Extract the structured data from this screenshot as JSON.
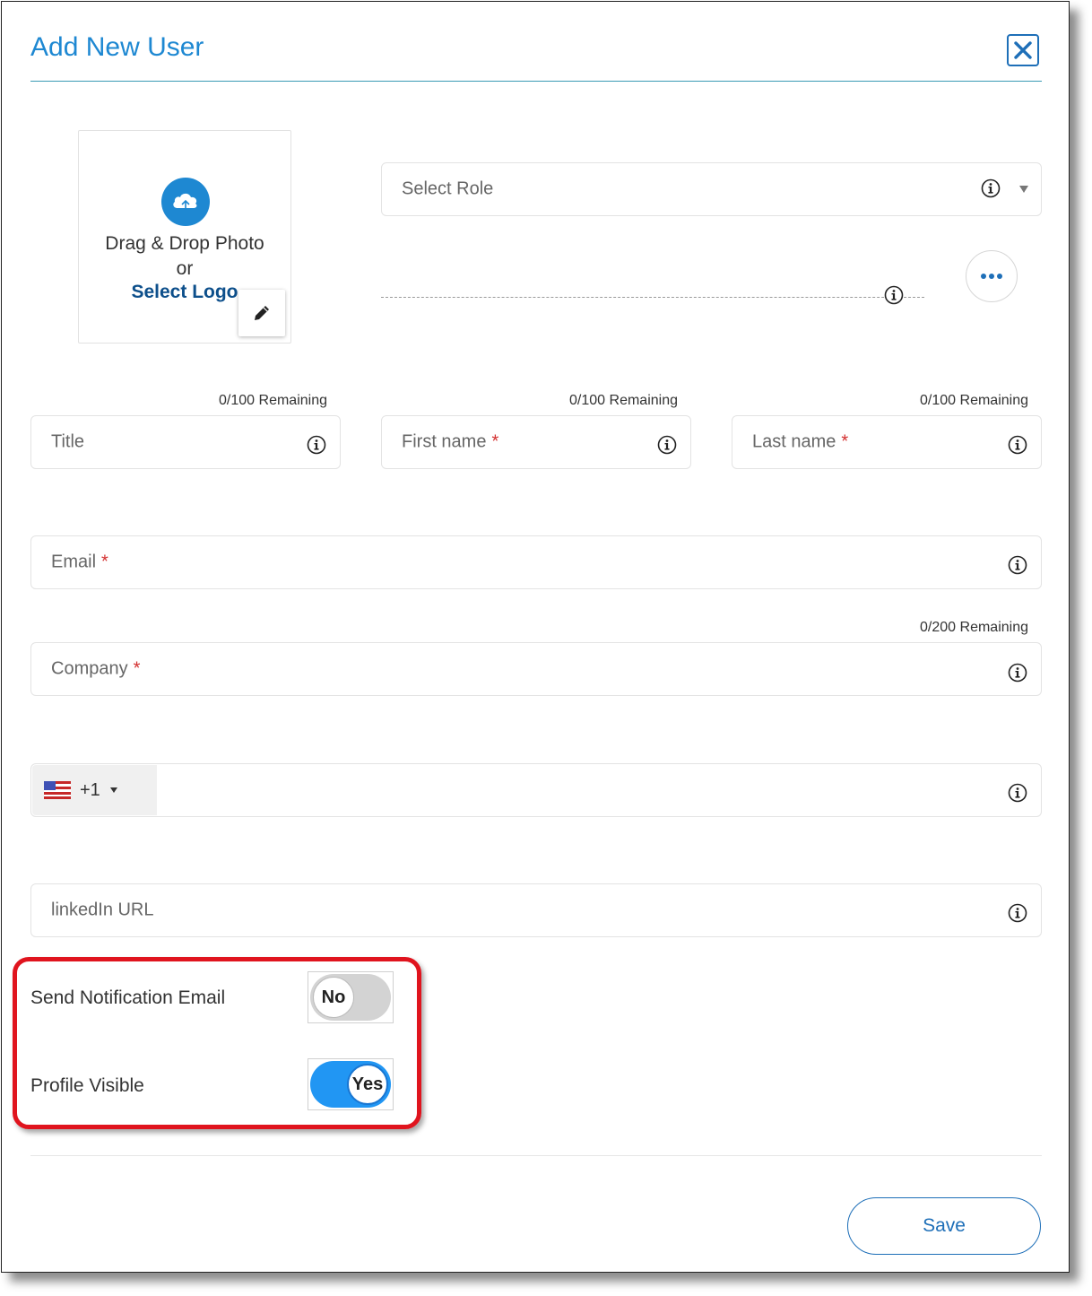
{
  "dialog": {
    "title": "Add New User"
  },
  "photo": {
    "drag_text": "Drag & Drop Photo",
    "or_text": "or",
    "select_logo": "Select Logo"
  },
  "role": {
    "placeholder": "Select Role"
  },
  "fields": {
    "title": {
      "placeholder": "Title",
      "remaining": "0/100 Remaining"
    },
    "first_name": {
      "placeholder": "First name",
      "required": "*",
      "remaining": "0/100 Remaining"
    },
    "last_name": {
      "placeholder": "Last name",
      "required": "*",
      "remaining": "0/100 Remaining"
    },
    "email": {
      "placeholder": "Email",
      "required": "*"
    },
    "company": {
      "placeholder": "Company",
      "required": "*",
      "remaining": "0/200 Remaining"
    },
    "phone": {
      "country_code": "+1",
      "flag": "us-flag-icon"
    },
    "linkedin": {
      "placeholder": "linkedIn URL"
    }
  },
  "toggles": {
    "send_notification": {
      "label": "Send Notification Email",
      "value": "No"
    },
    "profile_visible": {
      "label": "Profile Visible",
      "value": "Yes"
    }
  },
  "actions": {
    "save": "Save"
  },
  "colors": {
    "accent": "#1e88d2",
    "toggle_on": "#2196f3",
    "toggle_off": "#d3d3d3",
    "highlight": "#e0141e",
    "required": "#d32f2f"
  }
}
